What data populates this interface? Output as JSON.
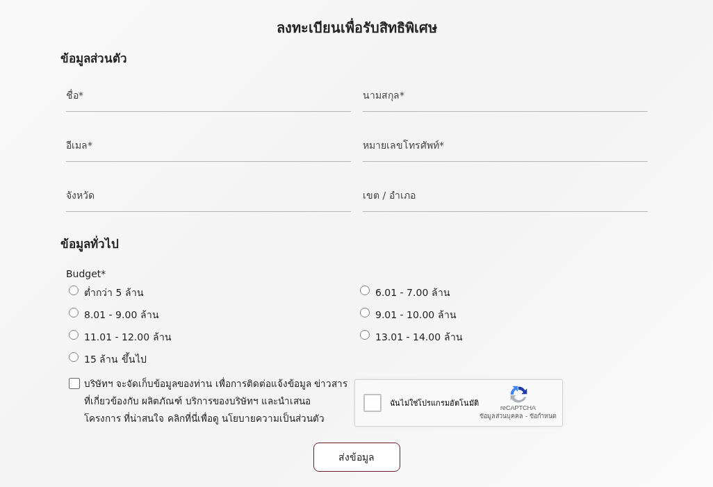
{
  "title": "ลงทะเบียนเพื่อรับสิทธิพิเศษ",
  "sections": [
    {
      "heading": "ข้อมูลส่วนตัว"
    },
    {
      "heading": "ข้อมูลทั่วไป"
    }
  ],
  "fields": [
    {
      "placeholder": "ชื่อ*"
    },
    {
      "placeholder": "นามสกุล*"
    },
    {
      "placeholder": "อีเมล*"
    },
    {
      "placeholder": "หมายเลขโทรศัพท์*"
    },
    {
      "placeholder": "จังหวัด"
    },
    {
      "placeholder": "เขต / อำเภอ"
    }
  ],
  "budget": {
    "label": "Budget*",
    "options": [
      {
        "label": "ต่ำกว่า 5 ล้าน",
        "selected": false
      },
      {
        "label": "6.01 - 7.00 ล้าน",
        "selected": false
      },
      {
        "label": "8.01 - 9.00 ล้าน",
        "selected": false
      },
      {
        "label": "9.01 - 10.00 ล้าน",
        "selected": false
      },
      {
        "label": "11.01 - 12.00 ล้าน",
        "selected": false
      },
      {
        "label": "13.01 - 14.00 ล้าน",
        "selected": false
      },
      {
        "label": "15 ล้าน ขึ้นไป",
        "selected": false
      }
    ]
  },
  "consent": {
    "checked": false,
    "text": "บริษัทฯ จะจัดเก็บข้อมูลของท่าน เพื่อการติดต่อแจ้งข้อมูล ข่าวสาร ที่เกี่ยวข้องกับ ผลิตภัณฑ์ บริการของบริษัทฯ และนำเสนอ โครงการ ที่น่าสนใจ คลิกที่นี่เพื่อดู นโยบายความเป็นส่วนตัว"
  },
  "captcha": {
    "checked": false,
    "label": "ฉันไม่ใช่โปรแกรมอัตโนมัติ",
    "brand": "reCAPTCHA",
    "links": [
      "ข้อมูลส่วนบุคคล",
      "ข้อกำหนด"
    ],
    "separator": "-"
  },
  "submit": "ส่งข้อมูล"
}
